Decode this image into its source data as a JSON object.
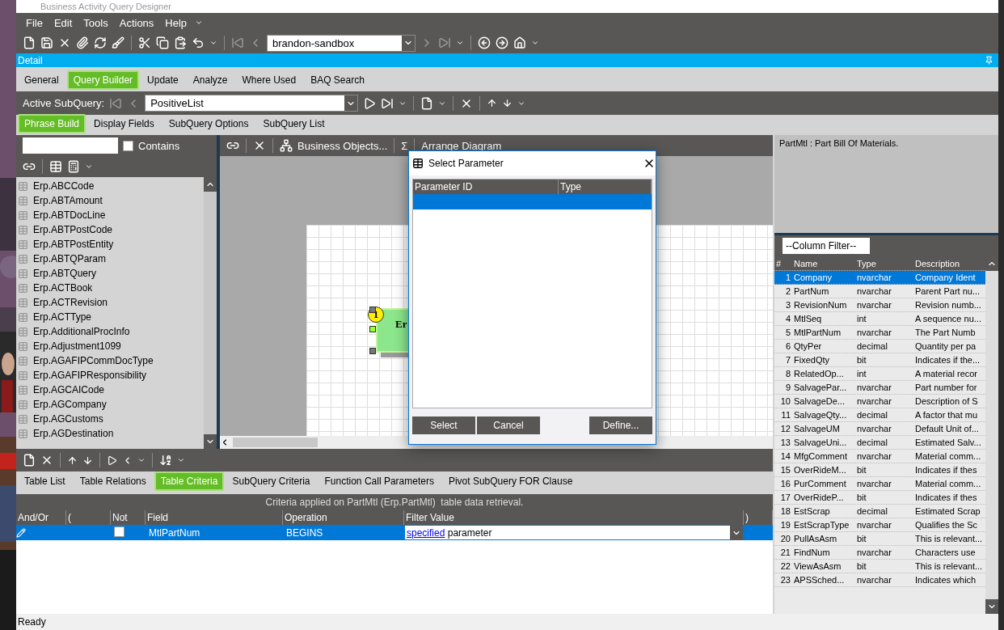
{
  "window": {
    "title": "Business Activity Query Designer"
  },
  "menu": [
    "File",
    "Edit",
    "Tools",
    "Actions",
    "Help"
  ],
  "toolbar": {
    "company": "brandon-sandbox"
  },
  "detail_bar": {
    "title": "Detail"
  },
  "tabs": [
    {
      "label": "General",
      "selected": false
    },
    {
      "label": "Query Builder",
      "selected": true
    },
    {
      "label": "Update",
      "selected": false
    },
    {
      "label": "Analyze",
      "selected": false
    },
    {
      "label": "Where Used",
      "selected": false
    },
    {
      "label": "BAQ Search",
      "selected": false
    }
  ],
  "subquery_bar": {
    "label": "Active SubQuery:",
    "value": "PositiveList"
  },
  "subtabs": [
    {
      "label": "Phrase Build",
      "selected": true
    },
    {
      "label": "Display Fields",
      "selected": false
    },
    {
      "label": "SubQuery Options",
      "selected": false
    },
    {
      "label": "SubQuery List",
      "selected": false
    }
  ],
  "table_search": {
    "contains_label": "Contains",
    "contains_checked": false
  },
  "tables": [
    "Erp.ABCCode",
    "Erp.ABTAmount",
    "Erp.ABTDocLine",
    "Erp.ABTPostCode",
    "Erp.ABTPostEntity",
    "Erp.ABTQParam",
    "Erp.ABTQuery",
    "Erp.ACTBook",
    "Erp.ACTRevision",
    "Erp.ACTType",
    "Erp.AdditionalProcInfo",
    "Erp.Adjustment1099",
    "Erp.AGAFIPCommDocType",
    "Erp.AGAFIPResponsibility",
    "Erp.AGCAICode",
    "Erp.AGCompany",
    "Erp.AGCustoms",
    "Erp.AGDestination"
  ],
  "diagram_toolbar": {
    "business_objects": "Business Objects...",
    "sum_symbol": "Σ",
    "arrange": "Arrange Diagram"
  },
  "diagram": {
    "node": {
      "number": "1",
      "title": "Er"
    }
  },
  "dialog": {
    "title": "Select Parameter",
    "columns": [
      "Parameter ID",
      "Type"
    ],
    "rows": [
      {
        "selected": true
      }
    ],
    "buttons": [
      "Select",
      "Cancel",
      "Define..."
    ]
  },
  "description": {
    "text": "PartMtl : Part Bill Of Materials."
  },
  "column_filter": {
    "value": "--Column Filter--"
  },
  "fields": {
    "columns": [
      "#",
      "Name",
      "Type",
      "Description"
    ],
    "rows": [
      {
        "num": "1",
        "name": "Company",
        "type": "nvarchar",
        "description": "Company Ident",
        "selected": true
      },
      {
        "num": "2",
        "name": "PartNum",
        "type": "nvarchar",
        "description": "Parent Part nu...",
        "selected": false
      },
      {
        "num": "3",
        "name": "RevisionNum",
        "type": "nvarchar",
        "description": "Revision numb...",
        "selected": false
      },
      {
        "num": "4",
        "name": "MtlSeq",
        "type": "int",
        "description": "A sequence nu...",
        "selected": false
      },
      {
        "num": "5",
        "name": "MtlPartNum",
        "type": "nvarchar",
        "description": "The Part Numb",
        "selected": false
      },
      {
        "num": "6",
        "name": "QtyPer",
        "type": "decimal",
        "description": "Quantity per pa",
        "selected": false
      },
      {
        "num": "7",
        "name": "FixedQty",
        "type": "bit",
        "description": "Indicates if the...",
        "selected": false
      },
      {
        "num": "8",
        "name": "RelatedOp...",
        "type": "int",
        "description": "A material recor",
        "selected": false
      },
      {
        "num": "9",
        "name": "SalvagePar...",
        "type": "nvarchar",
        "description": "Part number for",
        "selected": false
      },
      {
        "num": "10",
        "name": "SalvageDe...",
        "type": "nvarchar",
        "description": "Description of S",
        "selected": false
      },
      {
        "num": "11",
        "name": "SalvageQty...",
        "type": "decimal",
        "description": "A factor that mu",
        "selected": false
      },
      {
        "num": "12",
        "name": "SalvageUM",
        "type": "nvarchar",
        "description": "Default Unit of...",
        "selected": false
      },
      {
        "num": "13",
        "name": "SalvageUni...",
        "type": "decimal",
        "description": "Estimated Salv...",
        "selected": false
      },
      {
        "num": "14",
        "name": "MfgComment",
        "type": "nvarchar",
        "description": "Material comm...",
        "selected": false
      },
      {
        "num": "15",
        "name": "OverRideM...",
        "type": "bit",
        "description": "Indicates if thes",
        "selected": false
      },
      {
        "num": "16",
        "name": "PurComment",
        "type": "nvarchar",
        "description": "Material comm...",
        "selected": false
      },
      {
        "num": "17",
        "name": "OverRideP...",
        "type": "bit",
        "description": "Indicates if thes",
        "selected": false
      },
      {
        "num": "18",
        "name": "EstScrap",
        "type": "decimal",
        "description": "Estimated Scrap",
        "selected": false
      },
      {
        "num": "19",
        "name": "EstScrapType",
        "type": "nvarchar",
        "description": "Qualifies the Sc",
        "selected": false
      },
      {
        "num": "20",
        "name": "PullAsAsm",
        "type": "bit",
        "description": "This is relevant...",
        "selected": false
      },
      {
        "num": "21",
        "name": "FindNum",
        "type": "nvarchar",
        "description": "Characters use",
        "selected": false
      },
      {
        "num": "22",
        "name": "ViewAsAsm",
        "type": "bit",
        "description": "This is relevant...",
        "selected": false
      },
      {
        "num": "23",
        "name": "APSSched...",
        "type": "nvarchar",
        "description": "Indicates which",
        "selected": false
      }
    ]
  },
  "bottom_tabs": [
    {
      "label": "Table List",
      "selected": false
    },
    {
      "label": "Table Relations",
      "selected": false
    },
    {
      "label": "Table Criteria",
      "selected": true
    },
    {
      "label": "SubQuery Criteria",
      "selected": false
    },
    {
      "label": "Function Call Parameters",
      "selected": false
    },
    {
      "label": "Pivot SubQuery FOR Clause",
      "selected": false
    }
  ],
  "criteria": {
    "caption": "Criteria applied on PartMtl (Erp.PartMtl)  table data retrieval.",
    "columns": [
      "And/Or",
      "(",
      "Not",
      "Field",
      "Operation",
      "Filter Value",
      ")"
    ],
    "rows": [
      {
        "selected": true,
        "not_checked": false,
        "field": "MtlPartNum",
        "operation": "BEGINS",
        "filter_link": "specified",
        "filter_text": "parameter"
      }
    ]
  },
  "status_bar": "Ready"
}
